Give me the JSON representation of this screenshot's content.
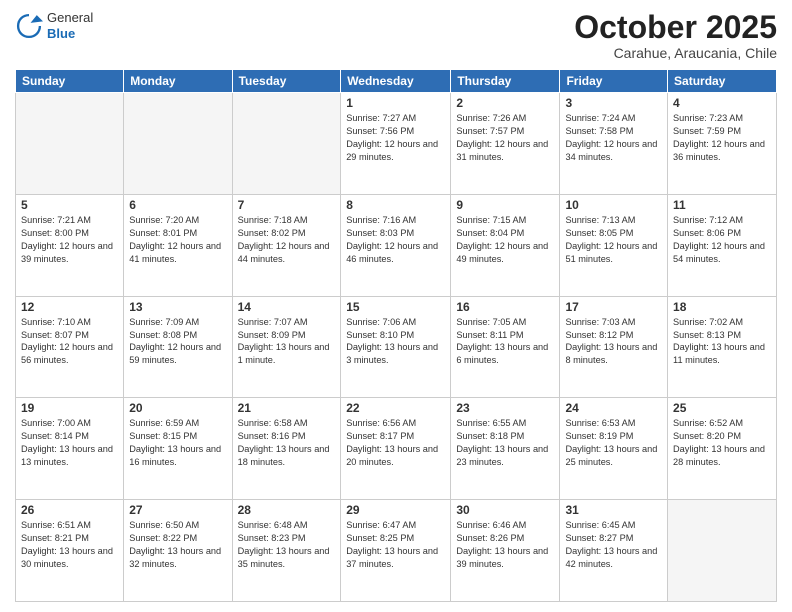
{
  "header": {
    "logo_general": "General",
    "logo_blue": "Blue",
    "month": "October 2025",
    "location": "Carahue, Araucania, Chile"
  },
  "weekdays": [
    "Sunday",
    "Monday",
    "Tuesday",
    "Wednesday",
    "Thursday",
    "Friday",
    "Saturday"
  ],
  "weeks": [
    [
      {
        "day": "",
        "info": ""
      },
      {
        "day": "",
        "info": ""
      },
      {
        "day": "",
        "info": ""
      },
      {
        "day": "1",
        "info": "Sunrise: 7:27 AM\nSunset: 7:56 PM\nDaylight: 12 hours\nand 29 minutes."
      },
      {
        "day": "2",
        "info": "Sunrise: 7:26 AM\nSunset: 7:57 PM\nDaylight: 12 hours\nand 31 minutes."
      },
      {
        "day": "3",
        "info": "Sunrise: 7:24 AM\nSunset: 7:58 PM\nDaylight: 12 hours\nand 34 minutes."
      },
      {
        "day": "4",
        "info": "Sunrise: 7:23 AM\nSunset: 7:59 PM\nDaylight: 12 hours\nand 36 minutes."
      }
    ],
    [
      {
        "day": "5",
        "info": "Sunrise: 7:21 AM\nSunset: 8:00 PM\nDaylight: 12 hours\nand 39 minutes."
      },
      {
        "day": "6",
        "info": "Sunrise: 7:20 AM\nSunset: 8:01 PM\nDaylight: 12 hours\nand 41 minutes."
      },
      {
        "day": "7",
        "info": "Sunrise: 7:18 AM\nSunset: 8:02 PM\nDaylight: 12 hours\nand 44 minutes."
      },
      {
        "day": "8",
        "info": "Sunrise: 7:16 AM\nSunset: 8:03 PM\nDaylight: 12 hours\nand 46 minutes."
      },
      {
        "day": "9",
        "info": "Sunrise: 7:15 AM\nSunset: 8:04 PM\nDaylight: 12 hours\nand 49 minutes."
      },
      {
        "day": "10",
        "info": "Sunrise: 7:13 AM\nSunset: 8:05 PM\nDaylight: 12 hours\nand 51 minutes."
      },
      {
        "day": "11",
        "info": "Sunrise: 7:12 AM\nSunset: 8:06 PM\nDaylight: 12 hours\nand 54 minutes."
      }
    ],
    [
      {
        "day": "12",
        "info": "Sunrise: 7:10 AM\nSunset: 8:07 PM\nDaylight: 12 hours\nand 56 minutes."
      },
      {
        "day": "13",
        "info": "Sunrise: 7:09 AM\nSunset: 8:08 PM\nDaylight: 12 hours\nand 59 minutes."
      },
      {
        "day": "14",
        "info": "Sunrise: 7:07 AM\nSunset: 8:09 PM\nDaylight: 13 hours\nand 1 minute."
      },
      {
        "day": "15",
        "info": "Sunrise: 7:06 AM\nSunset: 8:10 PM\nDaylight: 13 hours\nand 3 minutes."
      },
      {
        "day": "16",
        "info": "Sunrise: 7:05 AM\nSunset: 8:11 PM\nDaylight: 13 hours\nand 6 minutes."
      },
      {
        "day": "17",
        "info": "Sunrise: 7:03 AM\nSunset: 8:12 PM\nDaylight: 13 hours\nand 8 minutes."
      },
      {
        "day": "18",
        "info": "Sunrise: 7:02 AM\nSunset: 8:13 PM\nDaylight: 13 hours\nand 11 minutes."
      }
    ],
    [
      {
        "day": "19",
        "info": "Sunrise: 7:00 AM\nSunset: 8:14 PM\nDaylight: 13 hours\nand 13 minutes."
      },
      {
        "day": "20",
        "info": "Sunrise: 6:59 AM\nSunset: 8:15 PM\nDaylight: 13 hours\nand 16 minutes."
      },
      {
        "day": "21",
        "info": "Sunrise: 6:58 AM\nSunset: 8:16 PM\nDaylight: 13 hours\nand 18 minutes."
      },
      {
        "day": "22",
        "info": "Sunrise: 6:56 AM\nSunset: 8:17 PM\nDaylight: 13 hours\nand 20 minutes."
      },
      {
        "day": "23",
        "info": "Sunrise: 6:55 AM\nSunset: 8:18 PM\nDaylight: 13 hours\nand 23 minutes."
      },
      {
        "day": "24",
        "info": "Sunrise: 6:53 AM\nSunset: 8:19 PM\nDaylight: 13 hours\nand 25 minutes."
      },
      {
        "day": "25",
        "info": "Sunrise: 6:52 AM\nSunset: 8:20 PM\nDaylight: 13 hours\nand 28 minutes."
      }
    ],
    [
      {
        "day": "26",
        "info": "Sunrise: 6:51 AM\nSunset: 8:21 PM\nDaylight: 13 hours\nand 30 minutes."
      },
      {
        "day": "27",
        "info": "Sunrise: 6:50 AM\nSunset: 8:22 PM\nDaylight: 13 hours\nand 32 minutes."
      },
      {
        "day": "28",
        "info": "Sunrise: 6:48 AM\nSunset: 8:23 PM\nDaylight: 13 hours\nand 35 minutes."
      },
      {
        "day": "29",
        "info": "Sunrise: 6:47 AM\nSunset: 8:25 PM\nDaylight: 13 hours\nand 37 minutes."
      },
      {
        "day": "30",
        "info": "Sunrise: 6:46 AM\nSunset: 8:26 PM\nDaylight: 13 hours\nand 39 minutes."
      },
      {
        "day": "31",
        "info": "Sunrise: 6:45 AM\nSunset: 8:27 PM\nDaylight: 13 hours\nand 42 minutes."
      },
      {
        "day": "",
        "info": ""
      }
    ]
  ]
}
